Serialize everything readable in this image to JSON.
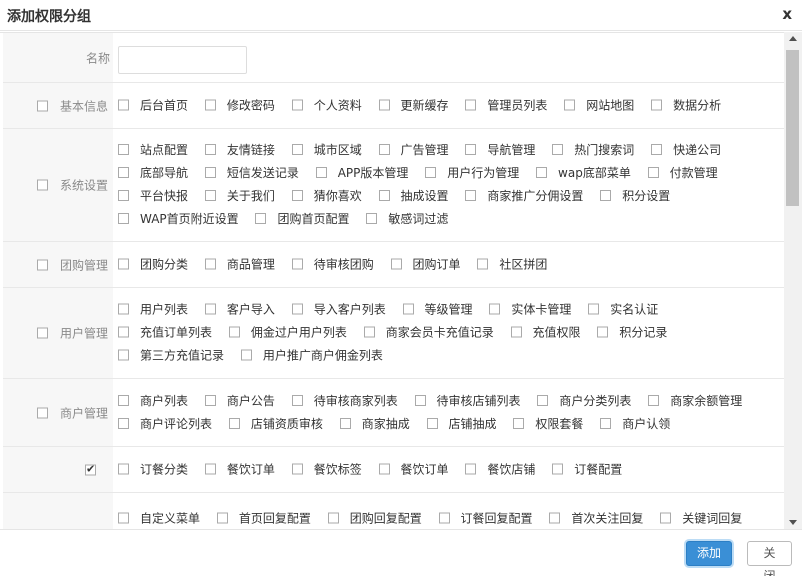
{
  "dialog": {
    "title": "添加权限分组",
    "close_glyph": "x"
  },
  "form": {
    "name_label": "名称",
    "name_value": "",
    "groups": [
      {
        "label": "基本信息",
        "checked": false,
        "items": [
          "后台首页",
          "修改密码",
          "个人资料",
          "更新缓存",
          "管理员列表",
          "网站地图",
          "数据分析"
        ]
      },
      {
        "label": "系统设置",
        "checked": false,
        "items": [
          "站点配置",
          "友情链接",
          "城市区域",
          "广告管理",
          "导航管理",
          "热门搜索词",
          "快递公司",
          "底部导航",
          "短信发送记录",
          "APP版本管理",
          "用户行为管理",
          "wap底部菜单",
          "付款管理",
          "平台快报",
          "关于我们",
          "猜你喜欢",
          "抽成设置",
          "商家推广分佣设置",
          "积分设置",
          "WAP首页附近设置",
          "团购首页配置",
          "敏感词过滤"
        ]
      },
      {
        "label": "团购管理",
        "checked": false,
        "items": [
          "团购分类",
          "商品管理",
          "待审核团购",
          "团购订单",
          "社区拼团"
        ]
      },
      {
        "label": "用户管理",
        "checked": false,
        "items": [
          "用户列表",
          "客户导入",
          "导入客户列表",
          "等级管理",
          "实体卡管理",
          "实名认证",
          "充值订单列表",
          "佣金过户用户列表",
          "商家会员卡充值记录",
          "充值权限",
          "积分记录",
          "第三方充值记录",
          "用户推广商户佣金列表"
        ]
      },
      {
        "label": "商户管理",
        "checked": false,
        "items": [
          "商户列表",
          "商户公告",
          "待审核商家列表",
          "待审核店铺列表",
          "商户分类列表",
          "商家余额管理",
          "商户评论列表",
          "店铺资质审核",
          "商家抽成",
          "店铺抽成",
          "权限套餐",
          "商户认领"
        ]
      },
      {
        "label": "",
        "checked": true,
        "items": [
          "订餐分类",
          "餐饮订单",
          "餐饮标签",
          "餐饮订单",
          "餐饮店铺",
          "订餐配置"
        ]
      },
      {
        "label": "",
        "checked": false,
        "items": [
          "自定义菜单",
          "首页回复配置",
          "团购回复配置",
          "订餐回复配置",
          "首次关注回复",
          "关键词回复"
        ]
      }
    ]
  },
  "footer": {
    "add_label": "添加",
    "close_label": "关闭"
  },
  "colors": {
    "primary": "#3a8fd6",
    "label_bg": "#f7f7f7"
  }
}
